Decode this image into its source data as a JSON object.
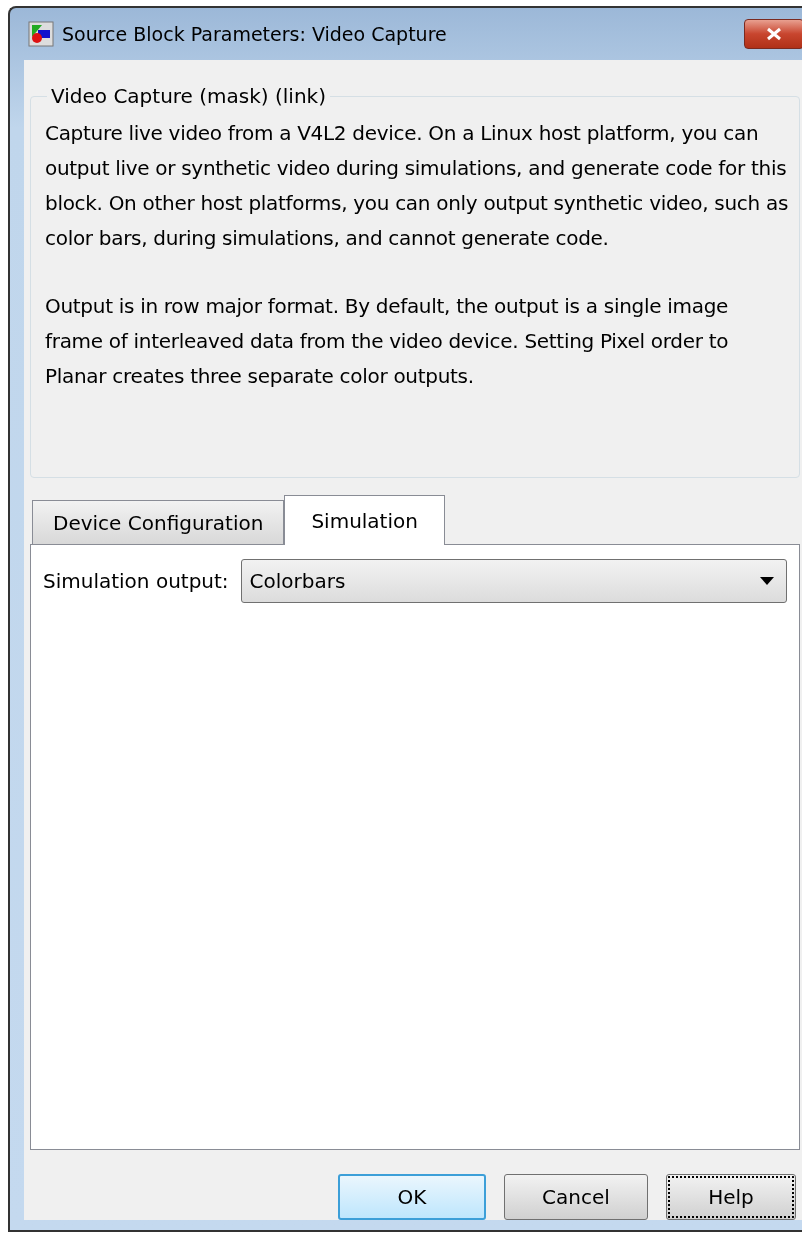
{
  "window": {
    "title": "Source Block Parameters: Video Capture"
  },
  "group": {
    "title": "Video Capture (mask) (link)",
    "paragraphs": [
      "Capture live video from a V4L2 device. On a Linux host platform, you can output live or synthetic video during simulations, and generate code for this block. On other host platforms, you can only output synthetic video, such as color bars, during simulations, and cannot generate code.",
      "Output is in row major format. By default, the output is a single image frame of interleaved data from the video device. Setting Pixel order to Planar creates three separate color outputs."
    ]
  },
  "tabs": [
    {
      "label": "Device Configuration",
      "selected": false
    },
    {
      "label": "Simulation",
      "selected": true
    }
  ],
  "fields": [
    {
      "label": "Simulation output:",
      "value": "Colorbars"
    }
  ],
  "buttons": [
    {
      "label": "OK",
      "kind": "default"
    },
    {
      "label": "Cancel",
      "kind": "normal"
    },
    {
      "label": "Help",
      "kind": "focused"
    }
  ]
}
